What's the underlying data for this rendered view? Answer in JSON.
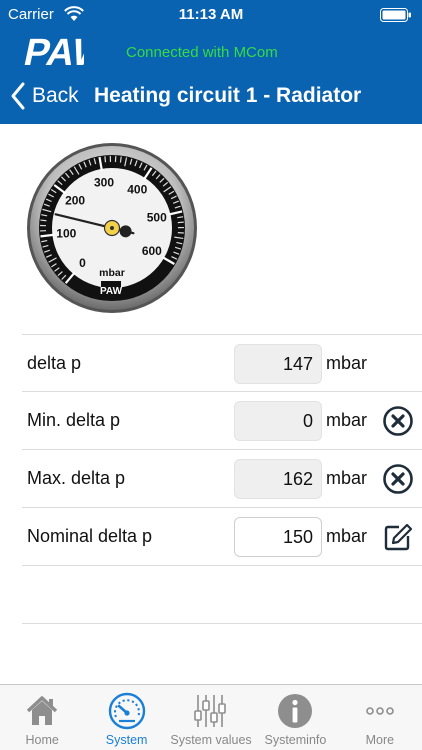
{
  "status_bar": {
    "carrier": "Carrier",
    "time": "11:13 AM"
  },
  "header": {
    "logo_text": "PAW",
    "connection_status": "Connected with MCom",
    "back_label": "Back",
    "title": "Heating circuit 1 - Radiator"
  },
  "gauge": {
    "unit": "mbar",
    "ticks": [
      "0",
      "100",
      "200",
      "300",
      "400",
      "500",
      "600"
    ],
    "min": 0,
    "max": 600,
    "needle_value": 147
  },
  "rows": [
    {
      "label": "delta p",
      "value": "147",
      "unit": "mbar",
      "editable": false,
      "action": ""
    },
    {
      "label": "Min. delta p",
      "value": "0",
      "unit": "mbar",
      "editable": false,
      "action": "reset-icon"
    },
    {
      "label": "Max. delta p",
      "value": "162",
      "unit": "mbar",
      "editable": false,
      "action": "reset-icon"
    },
    {
      "label": "Nominal delta p",
      "value": "150",
      "unit": "mbar",
      "editable": true,
      "action": "edit-icon"
    }
  ],
  "tabbar": {
    "tabs": [
      {
        "label": "Home",
        "icon": "home-icon",
        "active": false
      },
      {
        "label": "System",
        "icon": "gauge-icon",
        "active": true
      },
      {
        "label": "System values",
        "icon": "sliders-icon",
        "active": false
      },
      {
        "label": "Systeminfo",
        "icon": "info-icon",
        "active": false
      },
      {
        "label": "More",
        "icon": "more-icon",
        "active": false
      }
    ]
  },
  "colors": {
    "header_bg": "#0a63b0",
    "connected": "#33dd44",
    "tab_active": "#1a7fd6",
    "tab_inactive": "#8e8e8e"
  }
}
